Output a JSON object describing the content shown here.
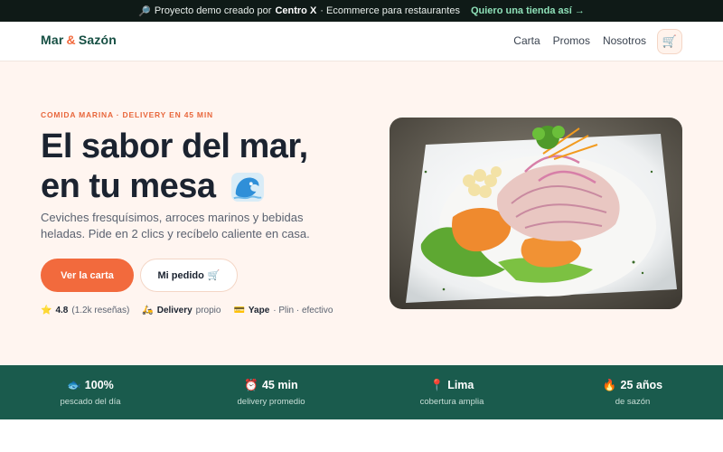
{
  "topbar": {
    "pin_icon": "pin-icon",
    "text_prefix": "Proyecto demo creado por",
    "brand": "Centro X",
    "text_suffix": "· Ecommerce para restaurantes",
    "cta": "Quiero una tienda así →"
  },
  "header": {
    "logo_a": "Mar",
    "logo_amp": "&",
    "logo_b": "Sazón",
    "nav": [
      "Carta",
      "Promos",
      "Nosotros"
    ],
    "cart_icon": "cart-icon"
  },
  "hero": {
    "kicker": "COMIDA MARINA · DELIVERY EN 45 MIN",
    "title_line1": "El sabor del mar,",
    "title_line2": "en tu mesa",
    "subtitle": "Ceviches fresquísimos, arroces marinos y bebidas heladas. Pide en 2 clics y recíbelo caliente en casa.",
    "primary_cta": "Ver la carta",
    "secondary_cta": "Mi pedido",
    "rating_value": "4.8",
    "rating_count": "(1.2k reseñas)",
    "delivery_label": "Delivery",
    "delivery_suffix": "propio",
    "pay_label": "Yape",
    "pay_suffix": "· Plin · efectivo"
  },
  "stats": [
    {
      "value": "100%",
      "label": "pescado del día",
      "icon": "fish-icon"
    },
    {
      "value": "45 min",
      "label": "delivery promedio",
      "icon": "clock-icon"
    },
    {
      "value": "Lima",
      "label": "cobertura amplia",
      "icon": "pin-icon"
    },
    {
      "value": "25 años",
      "label": "de sazón",
      "icon": "flame-icon"
    }
  ],
  "colors": {
    "accent": "#f26a3d",
    "brand_green": "#1a5b4d",
    "hero_bg": "#fff5f0"
  }
}
